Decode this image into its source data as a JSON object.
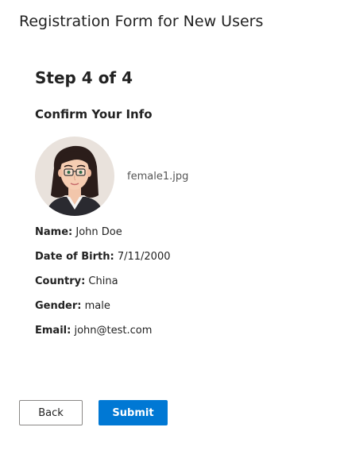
{
  "header": {
    "title": "Registration Form for New Users"
  },
  "step": {
    "title": "Step 4 of 4",
    "section_title": "Confirm Your Info"
  },
  "photo": {
    "file_name": "female1.jpg"
  },
  "info": {
    "name_label": "Name:",
    "name_value": "John Doe",
    "dob_label": "Date of Birth:",
    "dob_value": "7/11/2000",
    "country_label": "Country:",
    "country_value": "China",
    "gender_label": "Gender:",
    "gender_value": "male",
    "email_label": "Email:",
    "email_value": "john@test.com"
  },
  "actions": {
    "back_label": "Back",
    "submit_label": "Submit"
  },
  "colors": {
    "primary": "#0078d4",
    "text": "#222222",
    "muted": "#555555",
    "avatar_bg": "#e9e2dc"
  },
  "icons": {
    "avatar": "female-avatar-illustration"
  }
}
